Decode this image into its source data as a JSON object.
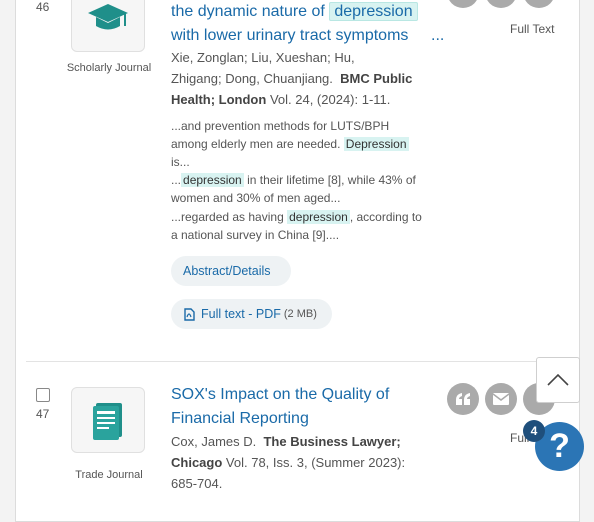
{
  "results": [
    {
      "number": "46",
      "type_label": "Scholarly Journal",
      "title_pre": "the dynamic nature of",
      "title_hl": "depression",
      "title_line2": "with lower urinary tract symptoms",
      "title_more": "...",
      "authors_line1": "Xie, Zonglan; Liu, Xueshan; Hu,",
      "authors_line2": "Zhigang; Dong, Chuanjiang.",
      "journal_a": "BMC Public",
      "journal_b": "Health; London",
      "pub_info": "Vol. 24,  (2024): 1-11.",
      "s1_pre": "...and prevention methods for LUTS/BPH",
      "s1_line2": "among elderly men are needed.",
      "s1_hl": "Depression",
      "s1_end": "is...",
      "s2_pre": "...",
      "s2_hl": "depression",
      "s2_mid": "in their lifetime [8], while 43% of",
      "s2_line2": "women and 30% of men aged...",
      "s3_pre": "...regarded as having",
      "s3_hl": "depression",
      "s3_post": ", according to",
      "s3_line2": "a national survey in China [9]....",
      "abstract_link": "Abstract/Details",
      "pdf_label": "Full text - PDF",
      "pdf_size": "(2 MB)",
      "fulltext_label": "Full Text"
    },
    {
      "number": "47",
      "type_label": "Trade Journal",
      "title_line1": "SOX's Impact on the Quality of",
      "title_line2": "Financial Reporting",
      "authors": "Cox, James D.",
      "journal_a": "The Business Lawyer;",
      "journal_b": "Chicago",
      "pub_info": "Vol. 78, Iss. 3,  (Summer 2023):",
      "pub_pages": "685-704.",
      "fulltext_label": "Full Text"
    }
  ],
  "widgets": {
    "badge_count": "4",
    "help_glyph": "?"
  },
  "colors": {
    "link": "#1a6aa8",
    "highlight": "#d8f3f1",
    "help_button": "#2b75b5"
  }
}
